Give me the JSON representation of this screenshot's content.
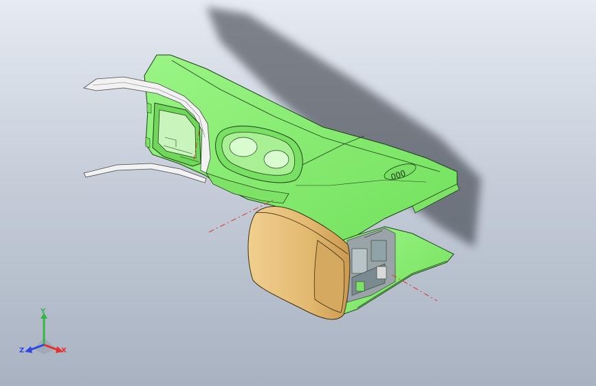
{
  "viewport": {
    "background_top": "#e6ebf1",
    "background_bottom": "#a9b2c1"
  },
  "model": {
    "part_color": "#86f071",
    "edge_color": "#1f3d1a",
    "armrest_color": "#e8c27d",
    "trim_color": "#f2f2f2",
    "shadow_color": "#2b2f36",
    "centerline_color": "#e0302a",
    "badge_text": "ООО"
  },
  "triad": {
    "x_label": "X",
    "y_label": "Y",
    "z_label": "Z",
    "x_color": "#e53030",
    "y_color": "#2fb845",
    "z_color": "#2f48e5"
  }
}
